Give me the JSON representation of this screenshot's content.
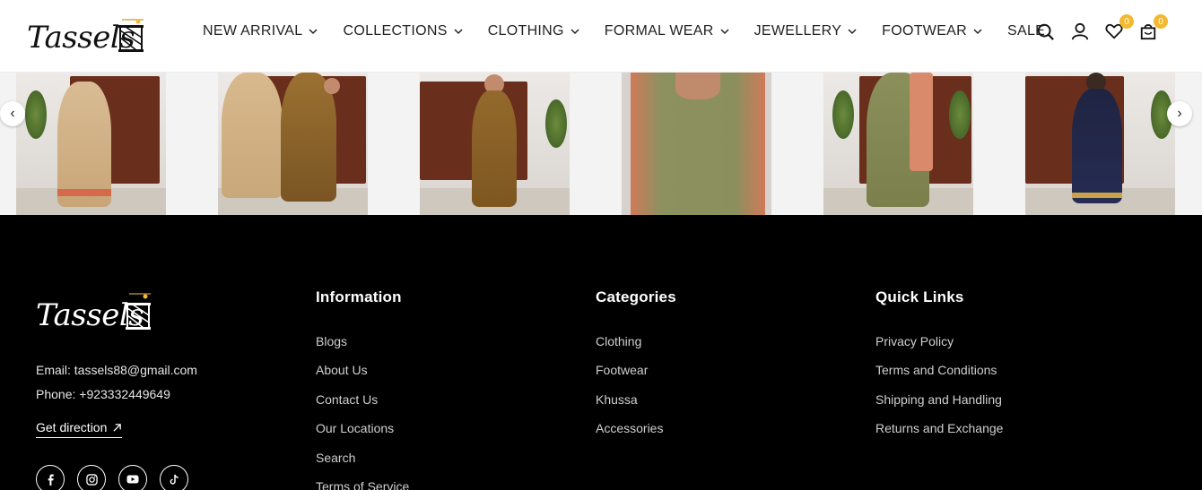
{
  "brand": {
    "name": "Tassels"
  },
  "nav": {
    "items": [
      {
        "label": "NEW ARRIVAL",
        "dropdown": true
      },
      {
        "label": "COLLECTIONS",
        "dropdown": true
      },
      {
        "label": "CLOTHING",
        "dropdown": true
      },
      {
        "label": "FORMAL WEAR",
        "dropdown": true
      },
      {
        "label": "JEWELLERY",
        "dropdown": true
      },
      {
        "label": "FOOTWEAR",
        "dropdown": true
      },
      {
        "label": "SALE",
        "dropdown": false
      }
    ]
  },
  "header_icons": {
    "search": "search-icon",
    "account": "user-icon",
    "wishlist": {
      "icon": "heart-icon",
      "count": "0"
    },
    "cart": {
      "icon": "cart-icon",
      "count": "0"
    }
  },
  "carousel": {
    "prev": "‹",
    "next": "›",
    "tiles": [
      {
        "outfit": "beige-gown"
      },
      {
        "outfit": "pair-beige-olive"
      },
      {
        "outfit": "boy-olive-kurta"
      },
      {
        "outfit": "olive-kurta-peach-dupatta"
      },
      {
        "outfit": "olive-gharara"
      },
      {
        "outfit": "navy-frock"
      }
    ]
  },
  "footer": {
    "email": "Email: tassels88@gmail.com",
    "phone": "Phone: +923332449649",
    "direction": "Get direction",
    "socials": [
      "facebook-icon",
      "instagram-icon",
      "youtube-icon",
      "tiktok-icon"
    ],
    "columns": [
      {
        "title": "Information",
        "links": [
          "Blogs",
          "About Us",
          "Contact Us",
          "Our Locations",
          "Search",
          "Terms of Service"
        ]
      },
      {
        "title": "Categories",
        "links": [
          "Clothing",
          "Footwear",
          "Khussa",
          "Accessories"
        ]
      },
      {
        "title": "Quick Links",
        "links": [
          "Privacy Policy",
          "Terms and Conditions",
          "Shipping and Handling",
          "Returns and Exchange"
        ]
      }
    ]
  },
  "colors": {
    "accent": "#f5b82e",
    "footer_bg": "#000000",
    "text": "#222222"
  }
}
